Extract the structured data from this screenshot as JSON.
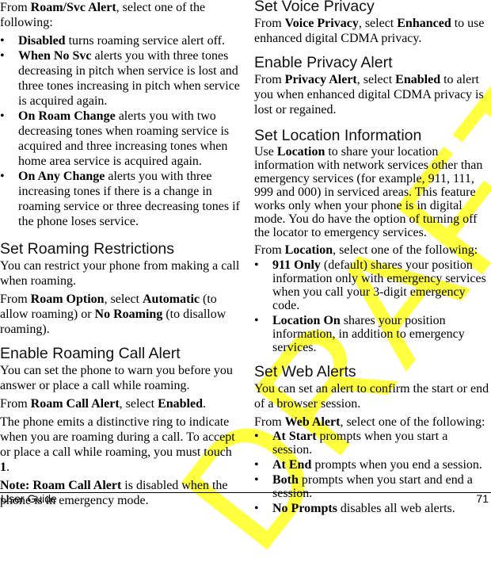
{
  "left_column": {
    "intro": {
      "pre": "From ",
      "bold": "Roam/Svc Alert",
      "post": ", select one of the following:"
    },
    "roam_alert_options": [
      {
        "bold": "Disabled",
        "text": " turns roaming service alert off."
      },
      {
        "bold": "When No Svc",
        "text": " alerts you with three tones decreasing in pitch when service is lost and three tones increasing in pitch when service is acquired again."
      },
      {
        "bold": "On Roam Change",
        "text": " alerts you with two decreasing tones when roaming service is acquired and three increasing tones when home area service is acquired again."
      },
      {
        "bold": "On Any Change",
        "text": " alerts you with three increasing tones if there is a change in roaming service or three decreasing tones if the phone loses service."
      }
    ],
    "roaming_restrictions": {
      "heading": "Set Roaming Restrictions",
      "para1": "You can restrict your phone from making a call when roaming.",
      "para2": {
        "pre": "From ",
        "b1": "Roam Option",
        "mid1": ", select ",
        "b2": "Automatic",
        "mid2": " (to allow roaming) or ",
        "b3": "No Roaming",
        "post": " (to disallow roaming)."
      }
    },
    "roaming_call_alert": {
      "heading": "Enable Roaming Call Alert",
      "para1": "You can set the phone to warn you before you answer or place a call while roaming.",
      "para2": {
        "pre": "From ",
        "b1": "Roam Call Alert",
        "mid": ", select ",
        "b2": "Enabled",
        "post": "."
      },
      "para3": {
        "pre": "The phone emits a distinctive ring to indicate when you are roaming during a call. To accept or place a call while roaming, you must touch ",
        "bold": "1",
        "post": "."
      },
      "note": {
        "b1": "Note: Roam Call Alert",
        "post": " is disabled when the phone is in emergency mode."
      }
    }
  },
  "right_column": {
    "voice_privacy": {
      "heading": "Set Voice Privacy",
      "para": {
        "pre": "From ",
        "b1": "Voice Privacy",
        "mid": ", select ",
        "b2": "Enhanced",
        "post": " to use enhanced digital CDMA privacy."
      }
    },
    "privacy_alert": {
      "heading": "Enable Privacy Alert",
      "para": {
        "pre": "From ",
        "b1": "Privacy Alert",
        "mid": ", select ",
        "b2": "Enabled",
        "post": " to alert you when enhanced digital CDMA privacy is lost or regained."
      }
    },
    "location": {
      "heading": "Set Location Information",
      "para1": {
        "pre": "Use ",
        "bold": "Location",
        "post": " to share your location information with network services other than emergency services (for example, 911, 111, 999 and 000) in serviced areas. This feature works only when your phone is in digital mode. You do have the option of turning off the locator to emergency services."
      },
      "para2": {
        "pre": "From ",
        "bold": "Location",
        "post": ", select one of the following:"
      },
      "options": [
        {
          "bold": "911 Only",
          "text": " (default) shares your position information only with emergency services when you call your 3-digit emergency code."
        },
        {
          "bold": "Location On",
          "text": " shares your position information, in addition to emergency services."
        }
      ]
    },
    "web_alerts": {
      "heading": "Set Web Alerts",
      "para1": "You can set an alert to confirm the start or end of a browser session.",
      "para2": {
        "pre": "From ",
        "bold": "Web Alert",
        "post": ", select one of the following:"
      },
      "options": [
        {
          "bold": "At Start",
          "text": " prompts when you start a session."
        },
        {
          "bold": "At End",
          "text": " prompts when you end a session."
        },
        {
          "bold": "Both",
          "text": " prompts when you start and end a session."
        },
        {
          "bold": "No Prompts",
          "text": " disables all web alerts."
        }
      ]
    }
  },
  "bullet_glyph": "•",
  "watermark": "DRAFT",
  "footer": {
    "left": "User Guide",
    "page_number": "71"
  }
}
